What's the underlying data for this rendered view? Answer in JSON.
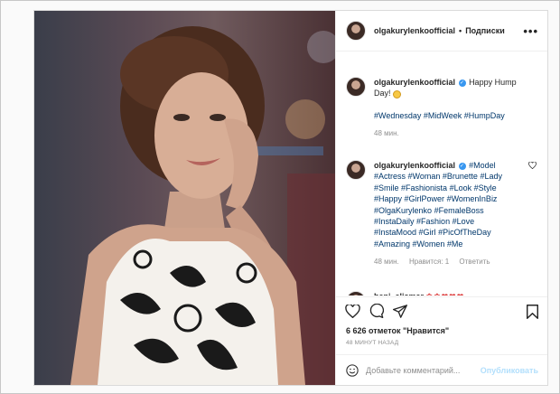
{
  "header": {
    "username": "olgakurylenkoofficial",
    "separator": "•",
    "follow_label": "Подписки",
    "more": "•••"
  },
  "caption": {
    "username": "olgakurylenkoofficial",
    "text": "Happy Hump Day!",
    "hashtags": "#Wednesday #MidWeek #HumpDay",
    "time": "48 мин."
  },
  "comment": {
    "username": "olgakurylenkoofficial",
    "hashtags": [
      "#Model",
      "#Actress",
      "#Woman",
      "#Brunette",
      "#Lady",
      "#Smile",
      "#Fashionista",
      "#Look",
      "#Style",
      "#Happy",
      "#GirlPower",
      "#WomenInBiz",
      "#OlgaKurylenko",
      "#FemaleBoss",
      "#InstaDaily",
      "#Fashion",
      "#Love",
      "#InstaMood",
      "#Girl",
      "#PicOfTheDay",
      "#Amazing",
      "#Women",
      "#Me"
    ],
    "time": "48 мин.",
    "likes": "Нравится: 1",
    "reply": "Ответить"
  },
  "next_comment": {
    "username": "beni_elismar"
  },
  "post": {
    "likes_text": "6 626 отметок \"Нравится\"",
    "time_ago": "48 МИНУТ НАЗАД"
  },
  "comment_box": {
    "placeholder": "Добавьте комментарий...",
    "publish_label": "Опубликовать"
  },
  "colors": {
    "link": "#00376b",
    "verified": "#3897f0",
    "muted": "#8e8e8e",
    "publish_disabled": "#b2dffc"
  }
}
